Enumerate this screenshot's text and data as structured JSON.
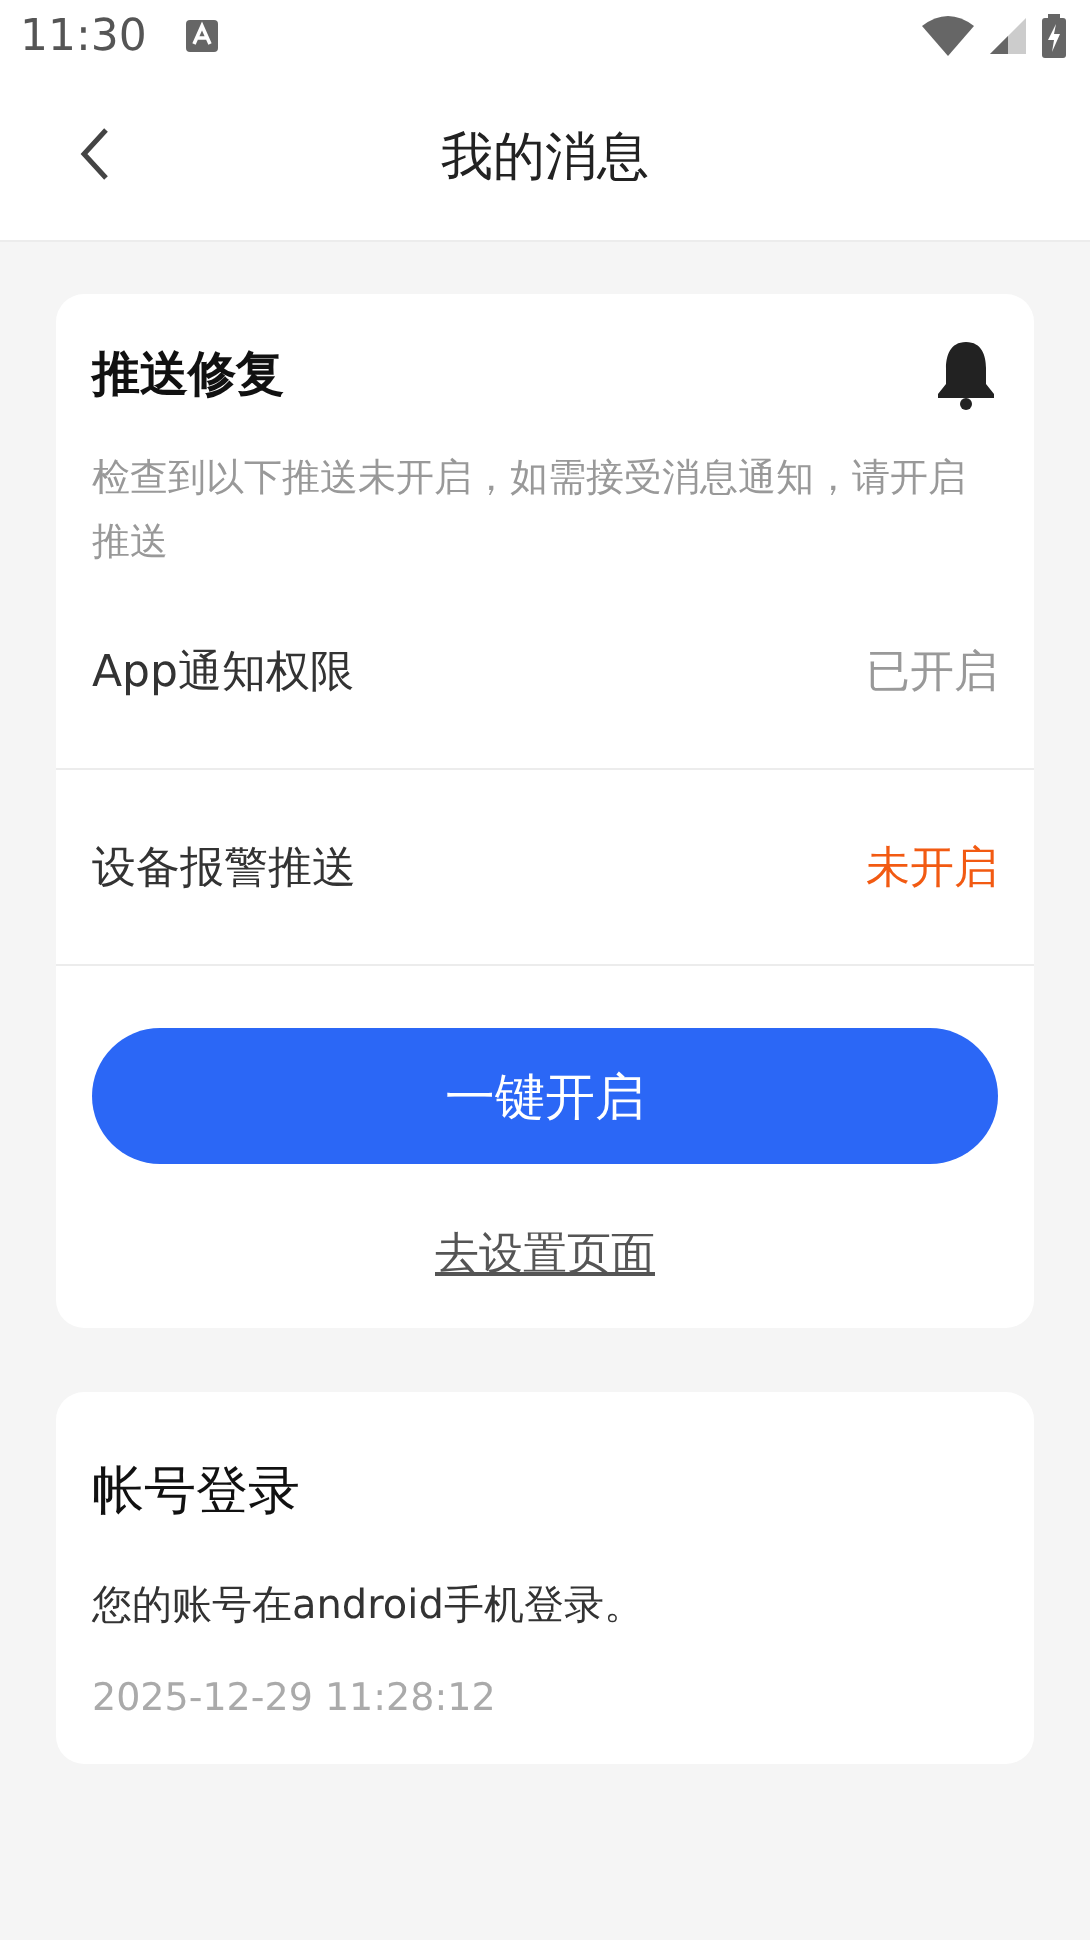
{
  "status_bar": {
    "time": "11:30"
  },
  "header": {
    "title": "我的消息"
  },
  "push_card": {
    "title": "推送修复",
    "description": "检查到以下推送未开启，如需接受消息通知，请开启推送",
    "rows": [
      {
        "label": "App通知权限",
        "status": "已开启",
        "enabled": true
      },
      {
        "label": "设备报警推送",
        "status": "未开启",
        "enabled": false
      }
    ],
    "button": "一键开启",
    "link": "去设置页面"
  },
  "login_card": {
    "title": "帐号登录",
    "message": "您的账号在android手机登录。",
    "time": "2025-12-29 11:28:12"
  }
}
